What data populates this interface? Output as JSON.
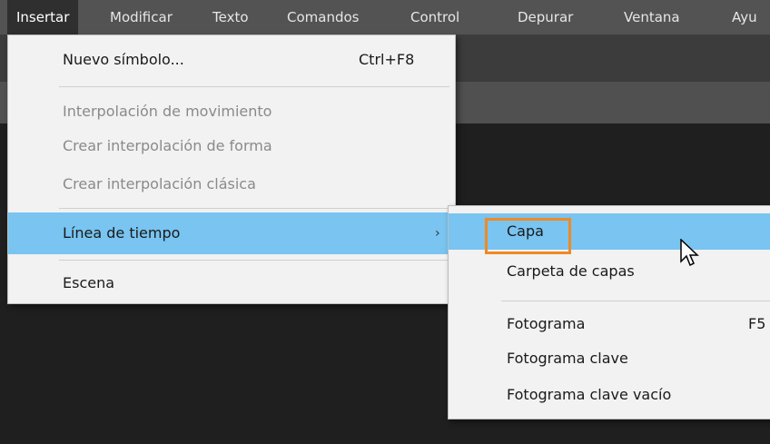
{
  "menubar": {
    "items": [
      "Insertar",
      "Modificar",
      "Texto",
      "Comandos",
      "Control",
      "Depurar",
      "Ventana",
      "Ayu"
    ]
  },
  "insert_menu": {
    "items": [
      {
        "label": "Nuevo símbolo...",
        "shortcut": "Ctrl+F8",
        "enabled": true
      },
      {
        "label": "Interpolación de movimiento",
        "enabled": false
      },
      {
        "label": "Crear interpolación de forma",
        "enabled": false
      },
      {
        "label": "Crear interpolación clásica",
        "enabled": false
      },
      {
        "label": "Línea de tiempo",
        "highlighted": true,
        "submenu_arrow": "›"
      },
      {
        "label": "Escena",
        "enabled": true
      }
    ]
  },
  "timeline_submenu": {
    "items": [
      {
        "label": "Capa",
        "highlighted": true,
        "outlined": true
      },
      {
        "label": "Carpeta de capas"
      },
      {
        "label": "Fotograma",
        "shortcut": "F5"
      },
      {
        "label": "Fotograma clave"
      },
      {
        "label": "Fotograma clave vacío"
      }
    ]
  },
  "colors": {
    "menubar_bg": "#535353",
    "menu_bg": "#f2f2f2",
    "highlight": "#79c4f0",
    "outline_accent": "#f08a24",
    "workspace_bg": "#1f1f1f"
  },
  "icons": {
    "pointer": "mouse-cursor-icon"
  }
}
